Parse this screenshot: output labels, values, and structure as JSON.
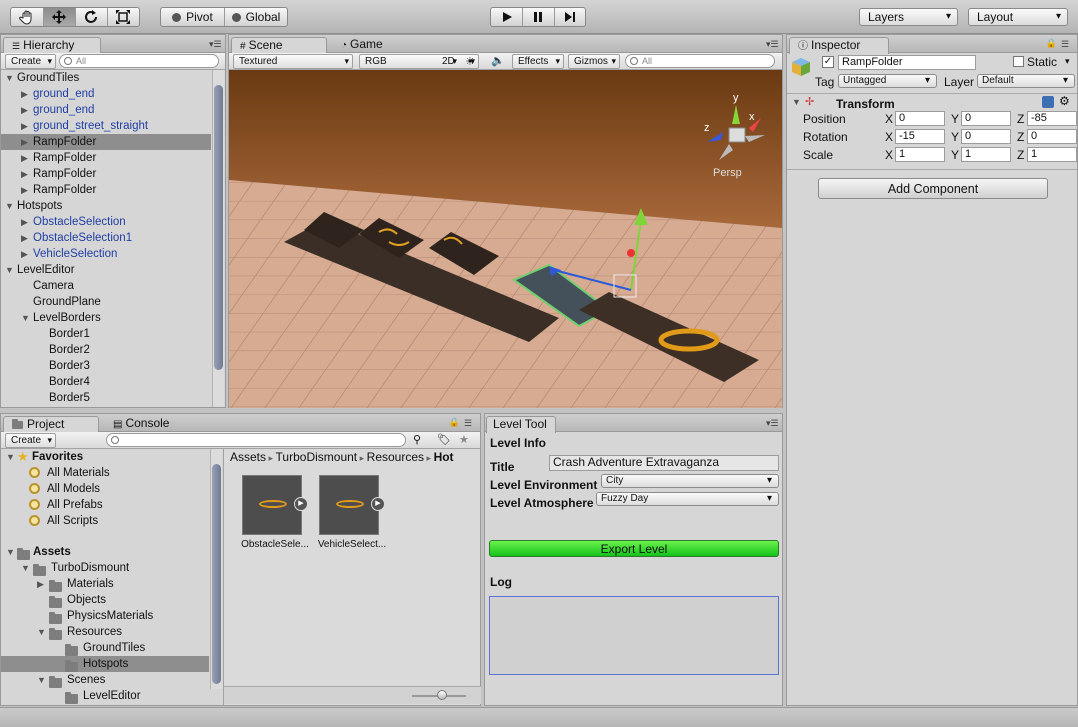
{
  "toolbar": {
    "pivot": "Pivot",
    "global": "Global",
    "layers": "Layers",
    "layout": "Layout"
  },
  "hierarchy": {
    "tab": "Hierarchy",
    "create": "Create",
    "search_placeholder": "All",
    "items": [
      {
        "label": "GroundTiles",
        "depth": 0,
        "arrow": "open",
        "style": "normal"
      },
      {
        "label": "ground_end",
        "depth": 1,
        "arrow": "closed",
        "style": "blue"
      },
      {
        "label": "ground_end",
        "depth": 1,
        "arrow": "closed",
        "style": "blue"
      },
      {
        "label": "ground_street_straight",
        "depth": 1,
        "arrow": "closed",
        "style": "blue"
      },
      {
        "label": "RampFolder",
        "depth": 1,
        "arrow": "closed",
        "style": "selected"
      },
      {
        "label": "RampFolder",
        "depth": 1,
        "arrow": "closed",
        "style": "normal"
      },
      {
        "label": "RampFolder",
        "depth": 1,
        "arrow": "closed",
        "style": "normal"
      },
      {
        "label": "RampFolder",
        "depth": 1,
        "arrow": "closed",
        "style": "normal"
      },
      {
        "label": "Hotspots",
        "depth": 0,
        "arrow": "open",
        "style": "normal"
      },
      {
        "label": "ObstacleSelection",
        "depth": 1,
        "arrow": "closed",
        "style": "blue"
      },
      {
        "label": "ObstacleSelection1",
        "depth": 1,
        "arrow": "closed",
        "style": "blue"
      },
      {
        "label": "VehicleSelection",
        "depth": 1,
        "arrow": "closed",
        "style": "blue"
      },
      {
        "label": "LevelEditor",
        "depth": 0,
        "arrow": "open",
        "style": "normal"
      },
      {
        "label": "Camera",
        "depth": 1,
        "arrow": "none",
        "style": "normal"
      },
      {
        "label": "GroundPlane",
        "depth": 1,
        "arrow": "none",
        "style": "normal"
      },
      {
        "label": "LevelBorders",
        "depth": 1,
        "arrow": "open",
        "style": "normal"
      },
      {
        "label": "Border1",
        "depth": 2,
        "arrow": "none",
        "style": "normal"
      },
      {
        "label": "Border2",
        "depth": 2,
        "arrow": "none",
        "style": "normal"
      },
      {
        "label": "Border3",
        "depth": 2,
        "arrow": "none",
        "style": "normal"
      },
      {
        "label": "Border4",
        "depth": 2,
        "arrow": "none",
        "style": "normal"
      },
      {
        "label": "Border5",
        "depth": 2,
        "arrow": "none",
        "style": "normal"
      }
    ]
  },
  "scene": {
    "tab_scene": "Scene",
    "tab_game": "Game",
    "render_mode": "Textured",
    "color_mode": "RGB",
    "toggle_2d": "2D",
    "effects": "Effects",
    "gizmos": "Gizmos",
    "search_placeholder": "All",
    "gizmo_y": "y",
    "gizmo_x": "x",
    "gizmo_z": "z",
    "persp": "Persp"
  },
  "inspector": {
    "tab": "Inspector",
    "object_name": "RampFolder",
    "static_label": "Static",
    "tag_label": "Tag",
    "tag_value": "Untagged",
    "layer_label": "Layer",
    "layer_value": "Default",
    "transform_title": "Transform",
    "position_label": "Position",
    "rotation_label": "Rotation",
    "scale_label": "Scale",
    "axis_x": "X",
    "axis_y": "Y",
    "axis_z": "Z",
    "position": {
      "x": "0",
      "y": "0",
      "z": "-85"
    },
    "rotation": {
      "x": "-15",
      "y": "0",
      "z": "0"
    },
    "scale": {
      "x": "1",
      "y": "1",
      "z": "1"
    },
    "add_component": "Add Component"
  },
  "project": {
    "tab_project": "Project",
    "tab_console": "Console",
    "create": "Create",
    "favorites_title": "Favorites",
    "favorites": [
      "All Materials",
      "All Models",
      "All Prefabs",
      "All Scripts"
    ],
    "assets_title": "Assets",
    "tree": [
      {
        "label": "TurboDismount",
        "depth": 1,
        "arrow": "open",
        "selected": false
      },
      {
        "label": "Materials",
        "depth": 2,
        "arrow": "closed",
        "selected": false
      },
      {
        "label": "Objects",
        "depth": 2,
        "arrow": "none",
        "selected": false
      },
      {
        "label": "PhysicsMaterials",
        "depth": 2,
        "arrow": "none",
        "selected": false
      },
      {
        "label": "Resources",
        "depth": 2,
        "arrow": "open",
        "selected": false
      },
      {
        "label": "GroundTiles",
        "depth": 3,
        "arrow": "none",
        "selected": false
      },
      {
        "label": "Hotspots",
        "depth": 3,
        "arrow": "none",
        "selected": true
      },
      {
        "label": "Scenes",
        "depth": 2,
        "arrow": "open",
        "selected": false
      },
      {
        "label": "LevelEditor",
        "depth": 3,
        "arrow": "none",
        "selected": false
      }
    ],
    "breadcrumb": [
      "Assets",
      "TurboDismount",
      "Resources",
      "Hot"
    ],
    "assets": [
      "ObstacleSele...",
      "VehicleSelect..."
    ]
  },
  "level_tool": {
    "tab": "Level Tool",
    "info_header": "Level Info",
    "title_label": "Title",
    "title_value": "Crash Adventure Extravaganza",
    "env_label": "Level Environment",
    "env_value": "City",
    "atmo_label": "Level Atmosphere",
    "atmo_value": "Fuzzy Day",
    "export_button": "Export Level",
    "log_label": "Log",
    "log_value": ""
  }
}
